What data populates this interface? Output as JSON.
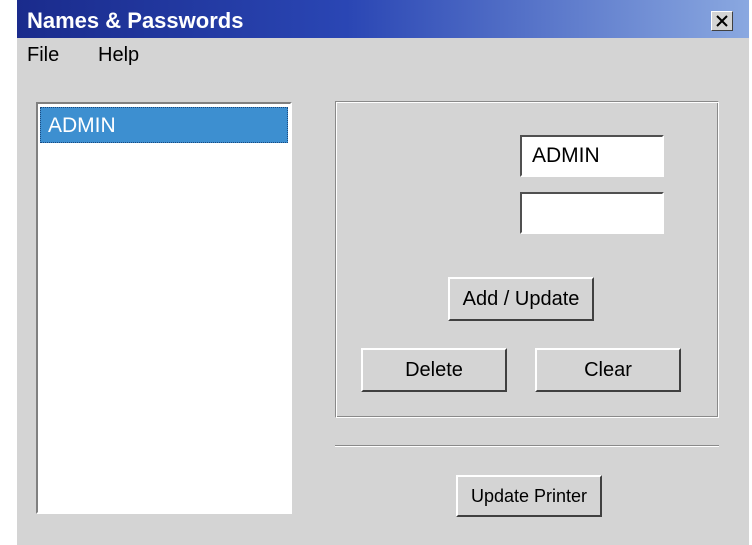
{
  "window": {
    "title": "Names & Passwords"
  },
  "menu": {
    "items": [
      "File",
      "Help"
    ]
  },
  "user_list": {
    "items": [
      "ADMIN"
    ],
    "selected": "ADMIN"
  },
  "form": {
    "name_value": "ADMIN",
    "password_value": "",
    "add_update_label": "Add / Update",
    "delete_label": "Delete",
    "clear_label": "Clear"
  },
  "footer": {
    "update_printer_label": "Update Printer"
  },
  "colors": {
    "titlebar_start": "#1a2b8c",
    "titlebar_end": "#8aa8e0",
    "selection": "#3d8fd0",
    "window_bg": "#d4d4d4"
  },
  "icons": {
    "close": "close-icon"
  }
}
